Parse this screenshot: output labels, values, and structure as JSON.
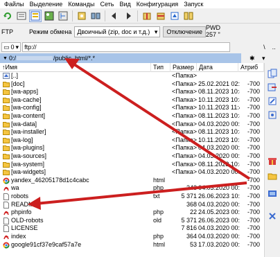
{
  "menu": [
    "Файлы",
    "Выделение",
    "Команды",
    "Сеть",
    "Вид",
    "Конфигурация",
    "Запуск"
  ],
  "toolbar_icons": [
    "refresh-icon",
    "view-brief-icon",
    "view-detail-icon",
    "thumbnails-icon",
    "tree-icon",
    "find-icon",
    "back-icon",
    "forward-icon",
    "pack-icon",
    "unpack-icon",
    "ftp-connect-icon",
    "compare-icon"
  ],
  "ftpbar": {
    "label": "FTP",
    "mode_label": "Режим обмена",
    "mode_value": "Двоичный (zip, doc и т.д.)",
    "disconnect": "Отключение",
    "pwd_line1": "PWD",
    "pwd_line2": "257 \""
  },
  "pathbar": {
    "drive": "0",
    "path": "ftp://",
    "right_symbols": [
      "\\",
      ".."
    ]
  },
  "current_path": "0:/",
  "current_path_suffix": "/public_html/*.*",
  "columns": {
    "name": "Имя",
    "type": "Тип",
    "size": "Размер",
    "date": "Дата",
    "attr": "Атриб"
  },
  "files": [
    {
      "icon": "up-icon",
      "name": "[..]",
      "type": "",
      "size": "<Папка>",
      "date": "",
      "attr": ""
    },
    {
      "icon": "folder-icon",
      "name": "[doc]",
      "type": "",
      "size": "<Папка>",
      "date": "25.02.2021 02:00",
      "attr": "-700"
    },
    {
      "icon": "folder-icon",
      "name": "[wa-apps]",
      "type": "",
      "size": "<Папка>",
      "date": "08.11.2023 10:44",
      "attr": "-700"
    },
    {
      "icon": "folder-icon",
      "name": "[wa-cache]",
      "type": "",
      "size": "<Папка>",
      "date": "10.11.2023 10:41",
      "attr": "-700"
    },
    {
      "icon": "folder-icon",
      "name": "[wa-config]",
      "type": "",
      "size": "<Папка>",
      "date": "10.11.2023 11:47",
      "attr": "-700"
    },
    {
      "icon": "folder-icon",
      "name": "[wa-content]",
      "type": "",
      "size": "<Папка>",
      "date": "08.11.2023 10:44",
      "attr": "-700"
    },
    {
      "icon": "folder-icon",
      "name": "[wa-data]",
      "type": "",
      "size": "<Папка>",
      "date": "04.03.2020 00:00",
      "attr": "-700"
    },
    {
      "icon": "folder-icon",
      "name": "[wa-installer]",
      "type": "",
      "size": "<Папка>",
      "date": "08.11.2023 10:44",
      "attr": "-700"
    },
    {
      "icon": "folder-icon",
      "name": "[wa-log]",
      "type": "",
      "size": "<Папка>",
      "date": "10.11.2023 10:50",
      "attr": "-700"
    },
    {
      "icon": "folder-icon",
      "name": "[wa-plugins]",
      "type": "",
      "size": "<Папка>",
      "date": "04.03.2020 00:00",
      "attr": "-700"
    },
    {
      "icon": "folder-icon",
      "name": "[wa-sources]",
      "type": "",
      "size": "<Папка>",
      "date": "04.03.2020 00:00",
      "attr": "-700"
    },
    {
      "icon": "folder-icon",
      "name": "[wa-system]",
      "type": "",
      "size": "<Папка>",
      "date": "08.11.2023 10:41",
      "attr": "-700"
    },
    {
      "icon": "folder-icon",
      "name": "[wa-widgets]",
      "type": "",
      "size": "<Папка>",
      "date": "04.03.2020 00:00",
      "attr": "-700"
    },
    {
      "icon": "chrome-icon",
      "name": "yandex_46205178d1c4cabc",
      "type": "html",
      "size": "",
      "date": "",
      "attr": "-700"
    },
    {
      "icon": "pdf-icon",
      "name": "wa",
      "type": "php",
      "size": "343",
      "date": "04.03.2020 00:00",
      "attr": "-700"
    },
    {
      "icon": "file-icon",
      "name": "robots",
      "type": "txt",
      "size": "5 371",
      "date": "26.06.2023 10:43",
      "attr": "-700"
    },
    {
      "icon": "file-icon",
      "name": "README",
      "type": "",
      "size": "368",
      "date": "04.03.2020 00:00",
      "attr": "-700"
    },
    {
      "icon": "pdf-icon",
      "name": "phpinfo",
      "type": "php",
      "size": "22",
      "date": "24.05.2023 00:00",
      "attr": "-700"
    },
    {
      "icon": "file-icon",
      "name": "OLD-robots",
      "type": "old",
      "size": "5 371",
      "date": "26.06.2023 00:00",
      "attr": "-700"
    },
    {
      "icon": "file-icon",
      "name": "LICENSE",
      "type": "",
      "size": "7 816",
      "date": "04.03.2020 00:00",
      "attr": "-700"
    },
    {
      "icon": "pdf-icon",
      "name": "index",
      "type": "php",
      "size": "364",
      "date": "04.03.2020 00:00",
      "attr": "-700"
    },
    {
      "icon": "chrome-icon",
      "name": "google91cf37e9caf57a7e",
      "type": "html",
      "size": "53",
      "date": "17.03.2020 00:00",
      "attr": "-700"
    }
  ],
  "colors": {
    "accent": "#cc1f1f",
    "path_highlight": "#a8c4e8",
    "folder": "#f5c542"
  }
}
